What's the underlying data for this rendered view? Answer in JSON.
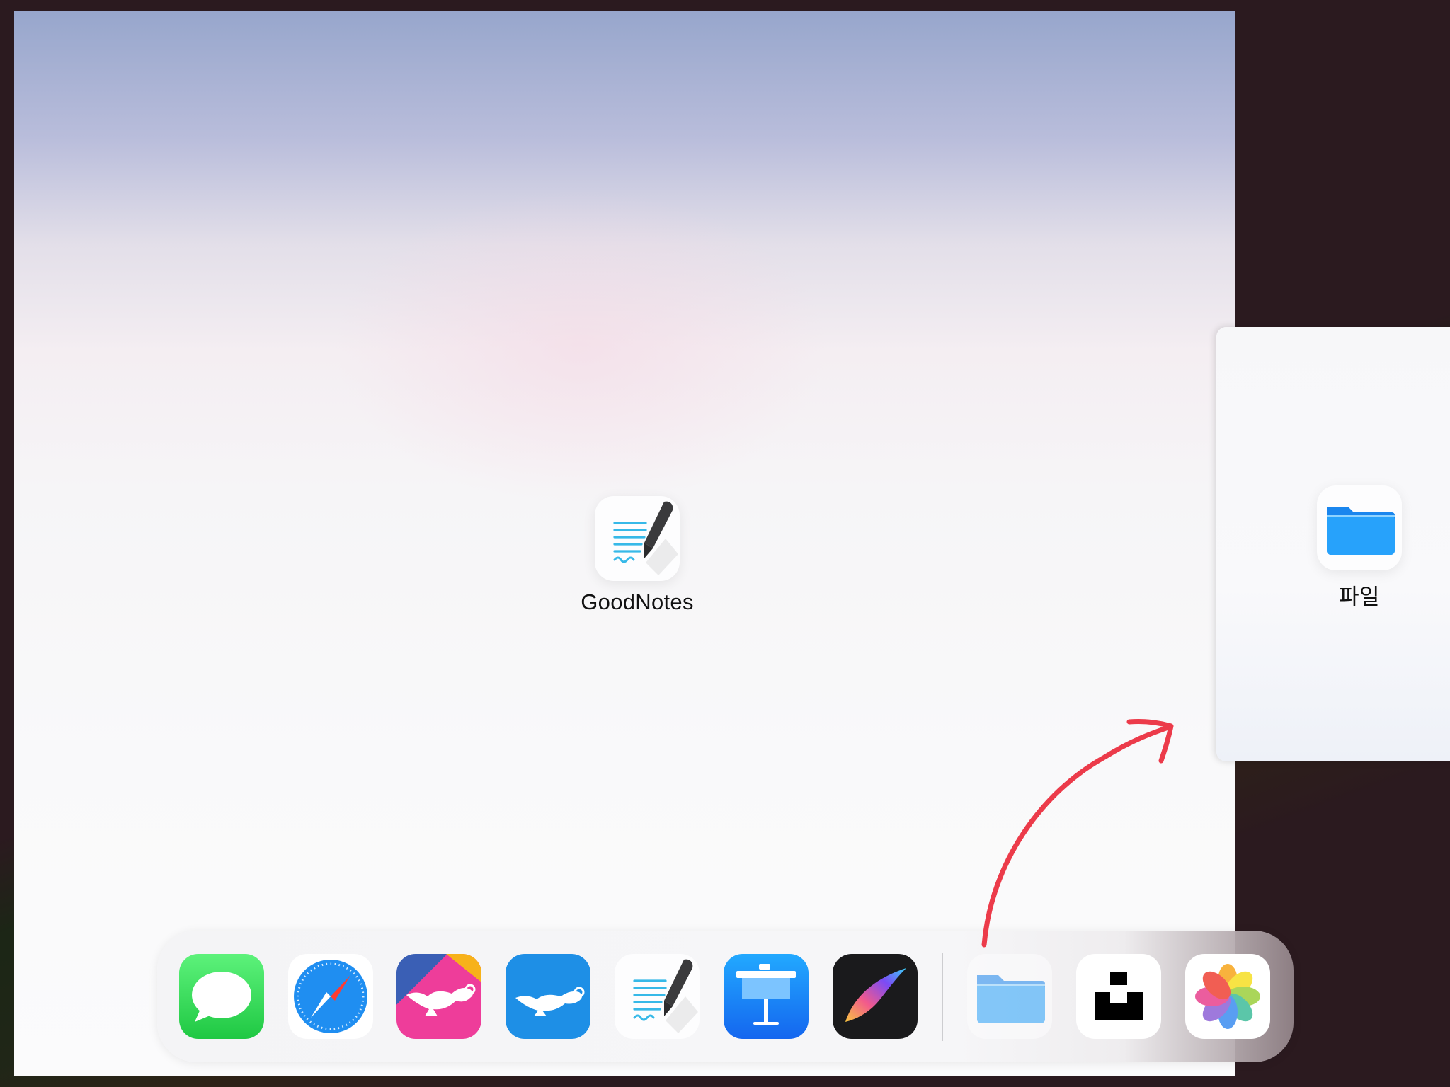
{
  "main_window": {
    "app_label": "GoodNotes",
    "app_icon": "goodnotes-icon"
  },
  "side_panel": {
    "app_label": "파일",
    "app_icon": "files-folder-icon"
  },
  "dock": {
    "apps": [
      {
        "icon": "messages-icon"
      },
      {
        "icon": "safari-icon"
      },
      {
        "icon": "genie-lamp-pink-icon"
      },
      {
        "icon": "genie-lamp-blue-icon"
      },
      {
        "icon": "goodnotes-icon"
      },
      {
        "icon": "keynote-icon"
      },
      {
        "icon": "procreate-icon"
      },
      {
        "icon": "files-folder-icon"
      },
      {
        "icon": "unsplash-icon"
      },
      {
        "icon": "photos-icon"
      }
    ]
  },
  "annotation": {
    "arrow_color": "#ec3b4a"
  },
  "colors": {
    "messages_green": "#2fd158",
    "safari_blue": "#1f8ef1",
    "files_blue": "#1d8bf1",
    "keynote_blue": "#1a82f5"
  }
}
